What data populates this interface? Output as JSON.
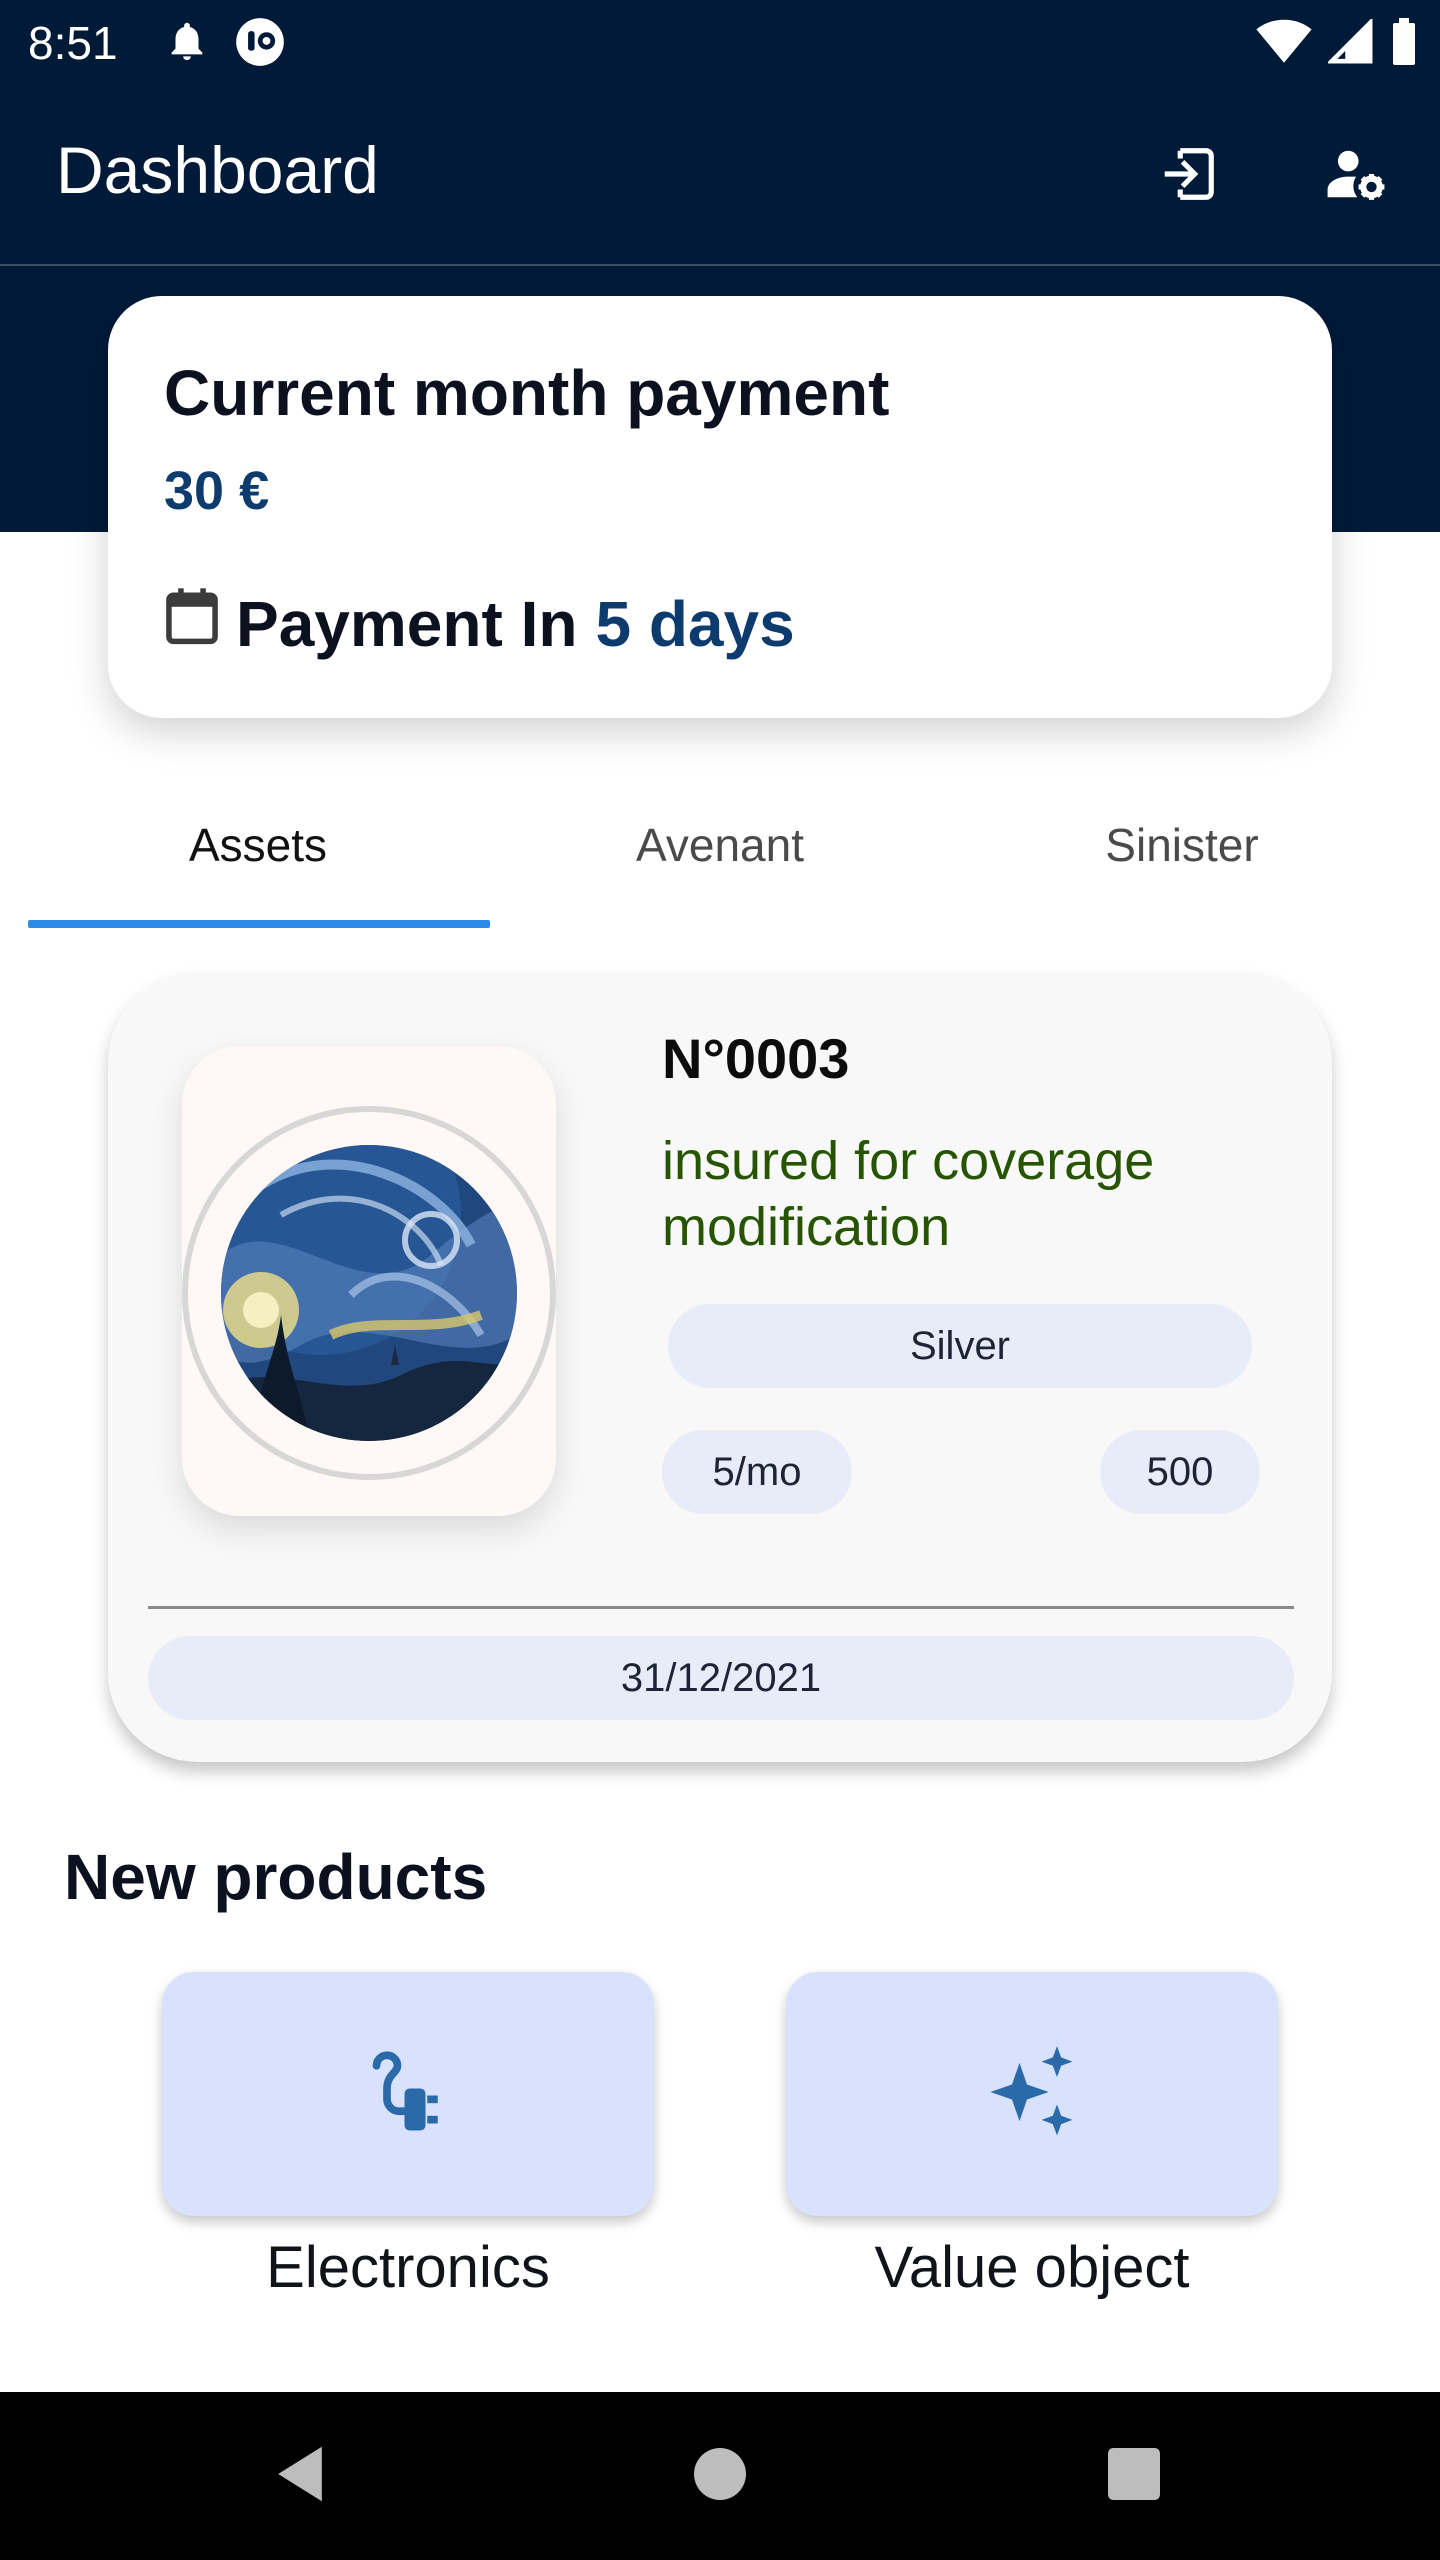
{
  "status_bar": {
    "time": "8:51",
    "left_icons": [
      "bell-icon",
      "app-badge-icon"
    ],
    "right_icons": [
      "wifi-icon",
      "signal-icon",
      "battery-icon"
    ]
  },
  "header": {
    "title": "Dashboard",
    "actions": [
      {
        "name": "logout-icon"
      },
      {
        "name": "user-settings-icon"
      }
    ],
    "background_color": "#001a38"
  },
  "payment": {
    "title": "Current month payment",
    "amount": "30 €",
    "due_prefix": "Payment In",
    "due_value": "5 days",
    "accent_color": "#0d3b6e"
  },
  "tabs": [
    {
      "label": "Assets",
      "active": true
    },
    {
      "label": "Avenant",
      "active": false
    },
    {
      "label": "Sinister",
      "active": false
    }
  ],
  "asset": {
    "number": "N°0003",
    "description": "insured for coverage modification",
    "plan": "Silver",
    "price": "5/mo",
    "coverage": "500",
    "date": "31/12/2021",
    "image": "starry-night-painting"
  },
  "new_products": {
    "title": "New products",
    "items": [
      {
        "label": "Electronics",
        "icon": "power-plug-icon"
      },
      {
        "label": "Value object",
        "icon": "sparkles-icon"
      }
    ]
  },
  "nav_bar": {
    "buttons": [
      "back-icon",
      "home-icon",
      "recents-icon"
    ]
  }
}
